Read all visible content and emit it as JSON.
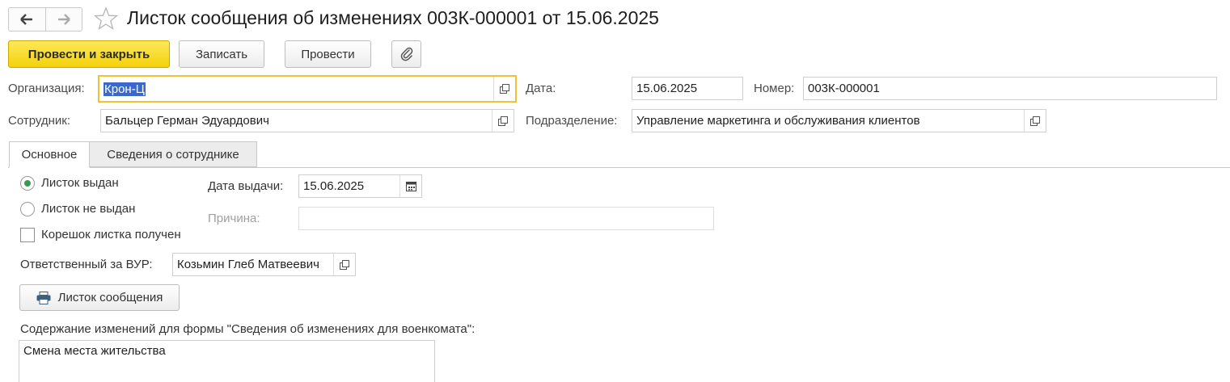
{
  "header": {
    "title": "Листок сообщения об изменениях 003К-000001 от 15.06.2025"
  },
  "toolbar": {
    "post_close_label": "Провести и закрыть",
    "save_label": "Записать",
    "post_label": "Провести"
  },
  "form": {
    "organization_label": "Организация:",
    "organization_value": "Крон-Ц",
    "date_label": "Дата:",
    "date_value": "15.06.2025",
    "number_label": "Номер:",
    "number_value": "003К-000001",
    "employee_label": "Сотрудник:",
    "employee_value": "Бальцер Герман Эдуардович",
    "department_label": "Подразделение:",
    "department_value": "Управление маркетинга и обслуживания клиентов"
  },
  "tabs": [
    {
      "label": "Основное"
    },
    {
      "label": "Сведения о сотруднике"
    }
  ],
  "main": {
    "radio_issued_label": "Листок выдан",
    "radio_not_issued_label": "Листок не выдан",
    "checkbox_stub_label": "Корешок листка получен",
    "issue_date_label": "Дата выдачи:",
    "issue_date_value": "15.06.2025",
    "reason_label": "Причина:",
    "reason_value": "",
    "responsible_label": "Ответственный за ВУР:",
    "responsible_value": "Козьмин Глеб Матвеевич",
    "print_button_label": "Листок сообщения",
    "content_label": "Содержание изменений для формы \"Сведения об изменениях для военкомата\":",
    "content_value": "Смена места жительства"
  },
  "state": {
    "radio_selected": "issued",
    "stub_received": false
  },
  "colors": {
    "primary_button": "#f4d10a",
    "focus_border": "#f2c230",
    "selection": "#3b69c9",
    "radio_dot": "#3a9a52"
  },
  "icons": [
    "arrow-left-icon",
    "arrow-right-icon",
    "star-icon",
    "paperclip-icon",
    "open-form-icon",
    "calendar-icon",
    "printer-icon"
  ]
}
